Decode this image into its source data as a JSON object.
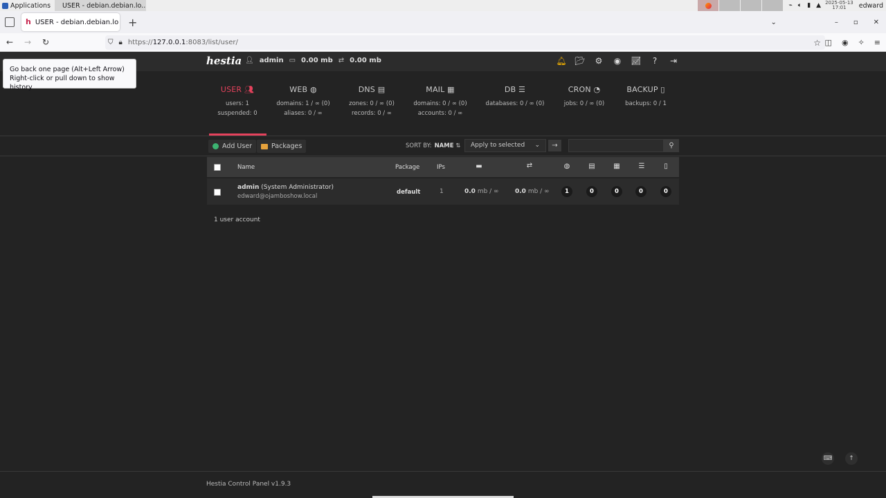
{
  "os": {
    "apps_label": "Applications",
    "task_title": "USER - debian.debian.lo...",
    "clock_date": "2025-05-13",
    "clock_time": "17:01",
    "user": "edward"
  },
  "browser": {
    "tab_title": "USER - debian.debian.lo",
    "url_prefix": "https://",
    "url_host": "127.0.0.1",
    "url_rest": ":8083/list/user/",
    "tooltip_line1": "Go back one page (Alt+Left Arrow)",
    "tooltip_line2": "Right-click or pull down to show history"
  },
  "topbar": {
    "logo": "hestia",
    "user": "admin",
    "disk": "0.00 mb",
    "bandwidth": "0.00 mb"
  },
  "stats": [
    {
      "title": "USER",
      "icon": "users-icon",
      "l1": "users: 1",
      "l2": "suspended: 0"
    },
    {
      "title": "WEB",
      "icon": "globe-icon",
      "l1": "domains: 1 / ∞ (0)",
      "l2": "aliases: 0 / ∞"
    },
    {
      "title": "DNS",
      "icon": "book-icon",
      "l1": "zones: 0 / ∞ (0)",
      "l2": "records: 0 / ∞"
    },
    {
      "title": "MAIL",
      "icon": "mail-icon",
      "l1": "domains: 0 / ∞ (0)",
      "l2": "accounts: 0 / ∞"
    },
    {
      "title": "DB",
      "icon": "database-icon",
      "l1": "databases: 0 / ∞ (0)",
      "l2": ""
    },
    {
      "title": "CRON",
      "icon": "clock-icon",
      "l1": "jobs: 0 / ∞ (0)",
      "l2": ""
    },
    {
      "title": "BACKUP",
      "icon": "file-icon",
      "l1": "backups: 0 / 1",
      "l2": ""
    }
  ],
  "toolbar": {
    "add_user": "Add User",
    "packages": "Packages",
    "sort_label": "SORT BY:",
    "sort_value": "NAME",
    "apply_selected": "Apply to selected"
  },
  "table": {
    "headers": {
      "name": "Name",
      "package": "Package",
      "ips": "IPs"
    },
    "row": {
      "username": "admin",
      "role": "(System Administrator)",
      "email": "edward@ojamboshow.local",
      "package": "default",
      "ips": "1",
      "disk_value": "0.0",
      "disk_unit": "mb / ∞",
      "bw_value": "0.0",
      "bw_unit": "mb / ∞",
      "web": "1",
      "dns": "0",
      "mail": "0",
      "db": "0",
      "backup": "0"
    },
    "count_text": "1 user account"
  },
  "footer": {
    "text": "Hestia Control Panel v1.9.3"
  }
}
